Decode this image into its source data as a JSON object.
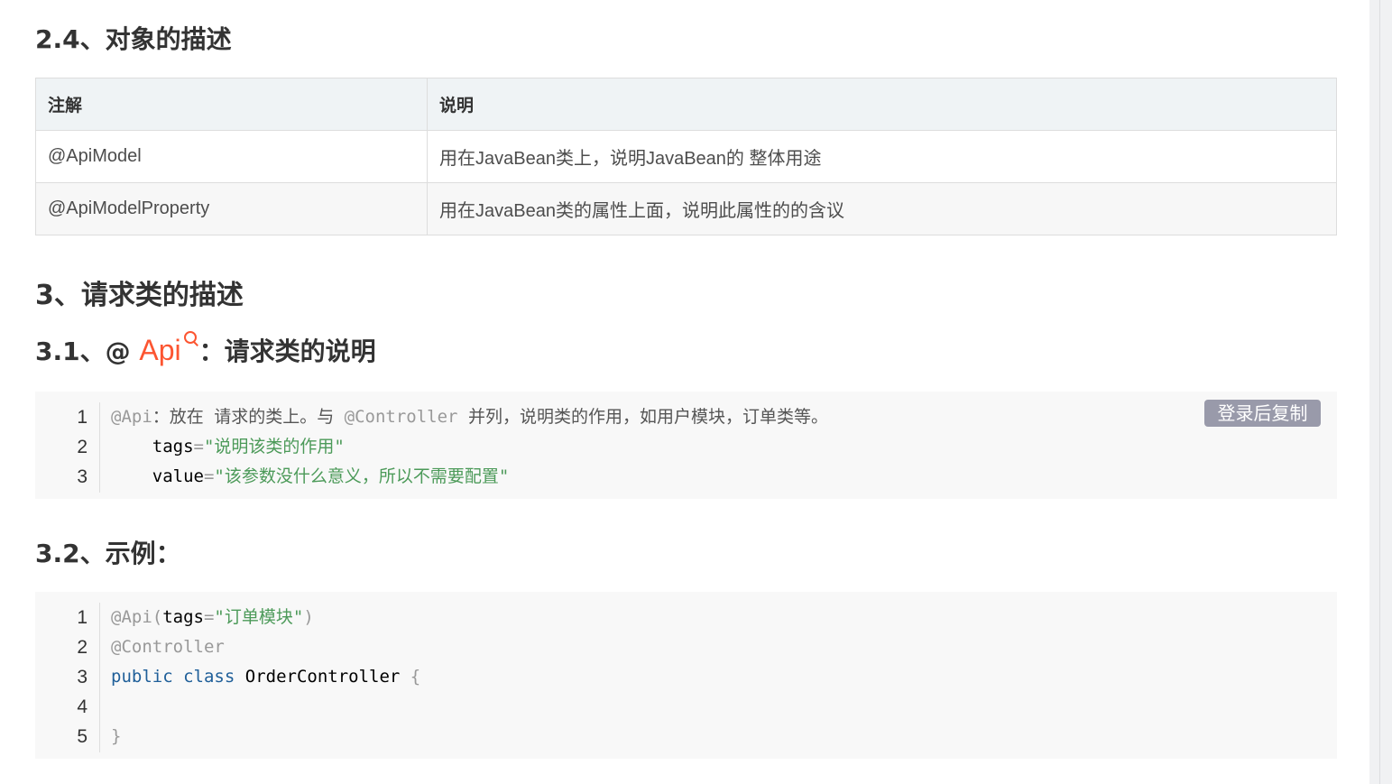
{
  "sections": {
    "object_desc": {
      "title": "2.4、对象的描述",
      "table": {
        "headers": [
          "注解",
          "说明"
        ],
        "rows": [
          [
            "@ApiModel",
            "用在JavaBean类上，说明JavaBean的 整体用途"
          ],
          [
            "@ApiModelProperty",
            "用在JavaBean类的属性上面，说明此属性的的含议"
          ]
        ]
      }
    },
    "request_desc": {
      "title": "3、请求类的描述"
    },
    "api_desc": {
      "title_prefix": "3.1、@ ",
      "title_link": "Api",
      "title_suffix": "：请求类的说明",
      "copy_button": "登录后复制",
      "line_numbers": [
        "1",
        "2",
        "3"
      ],
      "code": {
        "l1_anno": "@Api",
        "l1_text": "：放在 请求的类上。与 ",
        "l1_anno2": "@Controller",
        "l1_text2": " 并列，说明类的作用，如用户模块，订单类等。",
        "l2_key": "    tags",
        "l2_eq": "=",
        "l2_str": "\"说明该类的作用\"",
        "l3_key": "    value",
        "l3_eq": "=",
        "l3_str": "\"该参数没什么意义，所以不需要配置\""
      }
    },
    "example": {
      "title": "3.2、示例：",
      "line_numbers": [
        "1",
        "2",
        "3",
        "4",
        "5"
      ],
      "code": {
        "l1_anno": "@Api(",
        "l1_key": "tags",
        "l1_eq": "=",
        "l1_str": "\"订单模块\"",
        "l1_close": ")",
        "l2_anno": "@Controller",
        "l3_kw1": "public",
        "l3_kw2": "class",
        "l3_name": "OrderController",
        "l3_brace": "{",
        "l5_brace": "}"
      }
    }
  },
  "colors": {
    "link": "#fc5531",
    "string": "#4c9a59",
    "keyword": "#1f5f99",
    "annotation": "#999999",
    "copy_button_bg": "#999aaa"
  },
  "icons": [
    "search-icon"
  ]
}
